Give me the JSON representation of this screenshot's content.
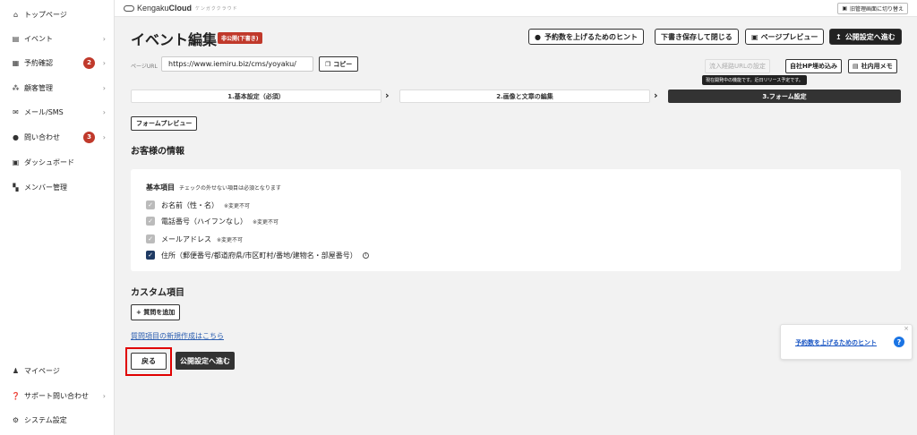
{
  "sidebar": {
    "items": [
      {
        "label": "トップページ",
        "icon": "home-icon"
      },
      {
        "label": "イベント",
        "icon": "document-icon"
      },
      {
        "label": "予約確認",
        "icon": "calendar-icon",
        "badge": "2"
      },
      {
        "label": "顧客管理",
        "icon": "users-icon"
      },
      {
        "label": "メール/SMS",
        "icon": "mail-icon"
      },
      {
        "label": "問い合わせ",
        "icon": "chat-icon",
        "badge": "3"
      },
      {
        "label": "ダッシュボード",
        "icon": "chart-icon"
      },
      {
        "label": "メンバー管理",
        "icon": "grid-icon"
      }
    ],
    "bottom": [
      {
        "label": "マイページ",
        "icon": "person-icon"
      },
      {
        "label": "サポート問い合わせ",
        "icon": "help-icon"
      },
      {
        "label": "システム設定",
        "icon": "gear-icon"
      }
    ]
  },
  "header": {
    "logo_brand": "Kengaku",
    "logo_bold": "Cloud",
    "logo_sub": "ケンガククラウド",
    "old_admin_label": "旧管理画面に切り替え"
  },
  "page": {
    "title": "イベント編集",
    "status": "非公開(下書き)",
    "btn_hint": "予約数を上げるためのヒント",
    "btn_save_close": "下書き保存して閉じる",
    "btn_preview": "ページプレビュー",
    "btn_publish": "公開設定へ進む"
  },
  "url": {
    "label": "ページURL",
    "value": "https://www.iemiru.biz/cms/yoyaku/",
    "copy_label": "コピー",
    "btn_inflow": "流入経路URLの設定",
    "btn_embed": "自社HP埋め込み",
    "btn_memo": "社内用メモ",
    "tooltip": "現在開発中の機能です。近日リリース予定です。"
  },
  "steps": [
    "1.基本設定（必須）",
    "2.画像と文章の編集",
    "3.フォーム設定"
  ],
  "form": {
    "preview_btn": "フォームプレビュー",
    "customer_title": "お客様の情報",
    "basic_title": "基本項目",
    "basic_note": "チェックの外せない項目は必須となります",
    "fields": [
      {
        "label": "お名前（性・名）",
        "note": "※変更不可",
        "checked": true,
        "locked": true
      },
      {
        "label": "電話番号（ハイフンなし）",
        "note": "※変更不可",
        "checked": true,
        "locked": true
      },
      {
        "label": "メールアドレス",
        "note": "※変更不可",
        "checked": true,
        "locked": true
      },
      {
        "label": "住所（郵便番号/都道府県/市区町村/番地/建物名・部屋番号）",
        "note": "",
        "checked": true,
        "locked": false
      }
    ],
    "custom_title": "カスタム項目",
    "add_question": "+ 質問を追加",
    "new_link": "質問項目の新規作成はこちら",
    "back_btn": "戻る",
    "publish_btn": "公開設定へ進む"
  },
  "hint_card": {
    "text": "予約数を上げるためのヒント",
    "help": "?",
    "close": "×"
  }
}
